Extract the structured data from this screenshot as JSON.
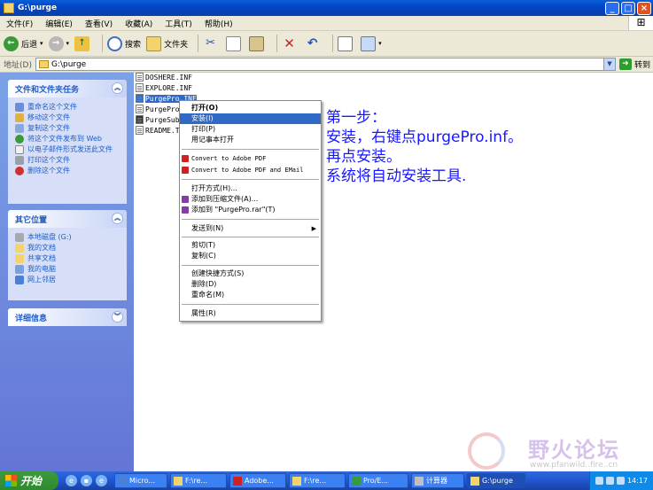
{
  "window": {
    "title": "G:\\purge"
  },
  "menubar": [
    "文件(F)",
    "编辑(E)",
    "查看(V)",
    "收藏(A)",
    "工具(T)",
    "帮助(H)"
  ],
  "toolbar": {
    "back": "后退",
    "search": "搜索",
    "folders": "文件夹"
  },
  "address": {
    "label": "地址(D)",
    "value": "G:\\purge",
    "go": "转到"
  },
  "left_panels": {
    "tasks": {
      "title": "文件和文件夹任务",
      "items": [
        "重命名这个文件",
        "移动这个文件",
        "复制这个文件",
        "将这个文件发布到 Web",
        "以电子邮件形式发送此文件",
        "打印这个文件",
        "删除这个文件"
      ]
    },
    "places": {
      "title": "其它位置",
      "items": [
        "本地磁盘 (G:)",
        "我的文档",
        "共享文档",
        "我的电脑",
        "网上邻居"
      ]
    },
    "details": {
      "title": "详细信息"
    }
  },
  "files": [
    "DOSHERE.INF",
    "EXPLORE.INF",
    "PurgePro.INF",
    "PurgeProS",
    "PurgeSubs",
    "README.TX"
  ],
  "context_menu": [
    "打开(O)",
    "安装(I)",
    "打印(P)",
    "用记事本打开",
    "Convert to Adobe PDF",
    "Convert to Adobe PDF and EMail",
    "打开方式(H)...",
    "添加到压缩文件(A)...",
    "添加到 \"PurgePro.rar\"(T)",
    "发送到(N)",
    "剪切(T)",
    "复制(C)",
    "创建快捷方式(S)",
    "删除(D)",
    "重命名(M)",
    "属性(R)"
  ],
  "note": [
    "第一步：",
    "安装，右键点purgePro.inf。",
    "再点安装。",
    "系统将自动安装工具."
  ],
  "watermark": {
    "text": "野火论坛",
    "url": "www.pfanwild..fire..cn"
  },
  "taskbar": {
    "start": "开始",
    "tasks": [
      "Micro...",
      "F:\\re...",
      "Adobe...",
      "F:\\re...",
      "Pro/E...",
      "计算器",
      "G:\\purge"
    ],
    "clock": "14:17"
  },
  "colors": {
    "title_blue": "#0a5fd8",
    "note_blue": "#1818ff",
    "highlight": "#316ac5"
  }
}
